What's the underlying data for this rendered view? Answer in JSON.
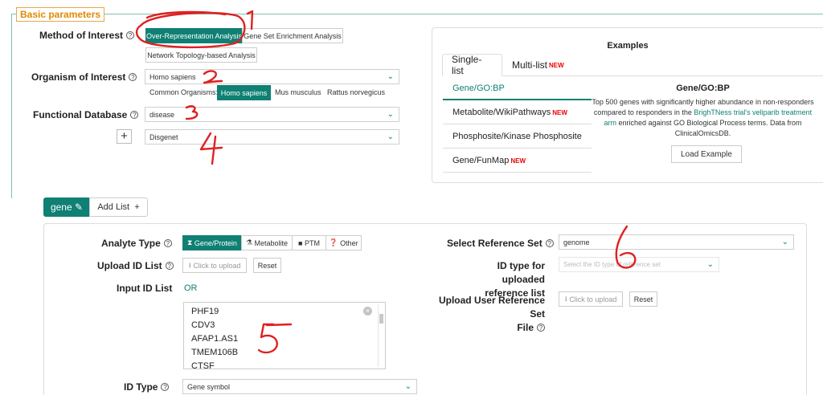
{
  "basic": {
    "legend": "Basic parameters",
    "method_label": "Method of Interest",
    "method_options": [
      "Over-Representation Analysis",
      "Gene Set Enrichment Analysis",
      "Network Topology-based Analysis"
    ],
    "organism_label": "Organism of Interest",
    "organism_value": "Homo sapiens",
    "common_label": "Common Organisms:",
    "common_organisms": [
      "Homo sapiens",
      "Mus musculus",
      "Rattus norvegicus"
    ],
    "database_label": "Functional Database",
    "database_value": "disease",
    "database2_value": "Disgenet",
    "add_symbol": "+"
  },
  "examples": {
    "title": "Examples",
    "tabs": [
      {
        "label": "Single-list"
      },
      {
        "label": "Multi-list",
        "badge": "NEW"
      }
    ],
    "items": [
      {
        "label": "Gene/GO:BP",
        "badge": ""
      },
      {
        "label": "Metabolite/WikiPathways",
        "badge": "NEW"
      },
      {
        "label": "Phosphosite/Kinase Phosphosite",
        "badge": ""
      },
      {
        "label": "Gene/FunMap",
        "badge": "NEW"
      }
    ],
    "selected_name": "Gene/GO:BP",
    "desc_1": "Top 500 genes with significantly higher abundance in non-responders compared to responders in the ",
    "desc_link": "BrighTNess trial's veliparib treatment arm",
    "desc_2": " enriched against GO Biological Process terms. Data from ClinicalOmicsDB.",
    "load_button": "Load Example"
  },
  "list_tabs": {
    "gene": "gene",
    "add": "Add List"
  },
  "analyte": {
    "label": "Analyte Type",
    "options": [
      "Gene/Protein",
      "Metabolite",
      "PTM",
      "Other"
    ],
    "upload_label": "Upload ID List",
    "upload_button": "Click to upload",
    "reset_button": "Reset",
    "input_label": "Input ID List",
    "or_text": "OR",
    "genes": [
      "PHF19",
      "CDV3",
      "AFAP1.AS1",
      "TMEM106B",
      "CTSF"
    ],
    "id_type_label": "ID Type",
    "id_type_value": "Gene symbol"
  },
  "reference": {
    "select_label": "Select Reference Set",
    "select_value": "genome",
    "id_type_label_1": "ID type for uploaded",
    "id_type_label_2": "reference list",
    "id_type_placeholder": "Select the ID type of reference set",
    "upload_label_1": "Upload User Reference Set",
    "upload_label_2": "File",
    "upload_button": "Click to upload",
    "reset_button": "Reset"
  },
  "annotations": {
    "numbers": [
      "1",
      "2",
      "3",
      "4",
      "5",
      "6"
    ],
    "color": "#e02020"
  },
  "colors": {
    "accent": "#0f8073",
    "legend": "#e08a00",
    "new_badge": "#ee0000"
  }
}
